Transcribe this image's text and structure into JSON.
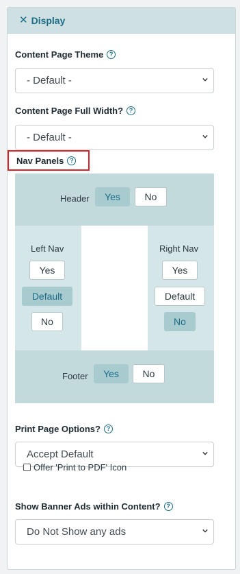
{
  "panel": {
    "title": "Display",
    "close_icon": "close-icon"
  },
  "content_theme": {
    "label": "Content Page Theme",
    "value": "- Default -"
  },
  "full_width": {
    "label": "Content Page Full Width?",
    "value": "- Default -"
  },
  "nav_panels": {
    "label": "Nav Panels",
    "header": {
      "label": "Header",
      "yes": "Yes",
      "no": "No",
      "selected": "Yes"
    },
    "left": {
      "label": "Left Nav",
      "yes": "Yes",
      "default": "Default",
      "no": "No",
      "selected": "Default"
    },
    "right": {
      "label": "Right Nav",
      "yes": "Yes",
      "default": "Default",
      "no": "No",
      "selected": "No"
    },
    "footer": {
      "label": "Footer",
      "yes": "Yes",
      "no": "No",
      "selected": "Yes"
    }
  },
  "print_options": {
    "label": "Print Page Options?",
    "value": "Accept Default",
    "checkbox_label": "Offer 'Print to PDF' Icon",
    "checkbox_checked": false
  },
  "banner_ads": {
    "label": "Show Banner Ads within Content?",
    "value": "Do Not Show any ads"
  },
  "colors": {
    "accent": "#1a6b86",
    "header_bg": "#cfe0e3",
    "nav_outer_bg": "#c3dadd",
    "nav_side_bg": "#d5e6e8",
    "active_btn_bg": "#a8cbd0",
    "highlight_border": "#d9252a"
  }
}
